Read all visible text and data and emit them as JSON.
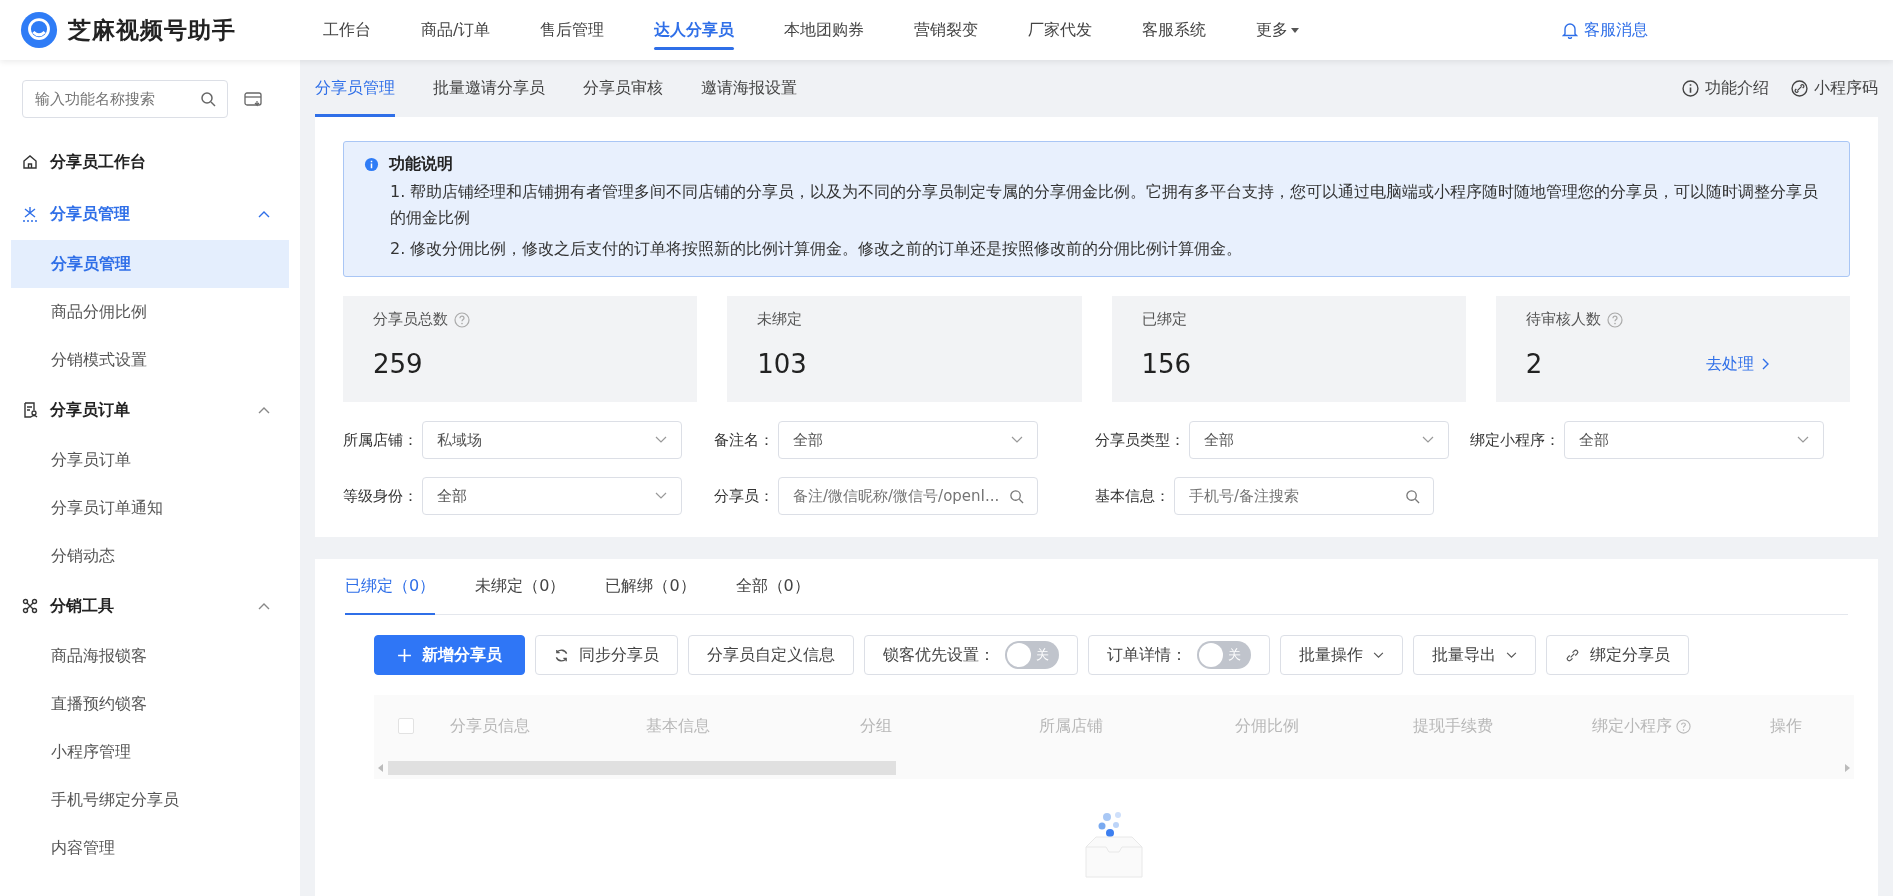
{
  "app": {
    "name": "芝麻视频号助手"
  },
  "top_nav": [
    {
      "label": "工作台",
      "selected": false
    },
    {
      "label": "商品/订单",
      "selected": false
    },
    {
      "label": "售后管理",
      "selected": false
    },
    {
      "label": "达人分享员",
      "selected": true
    },
    {
      "label": "本地团购券",
      "selected": false
    },
    {
      "label": "营销裂变",
      "selected": false
    },
    {
      "label": "厂家代发",
      "selected": false
    },
    {
      "label": "客服系统",
      "selected": false
    },
    {
      "label": "更多",
      "selected": false,
      "dropdown": true
    }
  ],
  "messages": {
    "label": "客服消息"
  },
  "sidebar": {
    "search": {
      "placeholder": "输入功能名称搜索"
    },
    "items": [
      {
        "label": "分享员工作台",
        "selected": false
      },
      {
        "label": "分享员管理",
        "selected": true,
        "expanded": true,
        "children": [
          {
            "label": "分享员管理",
            "selected": true
          },
          {
            "label": "商品分佣比例",
            "selected": false
          },
          {
            "label": "分销模式设置",
            "selected": false
          }
        ]
      },
      {
        "label": "分享员订单",
        "selected": false,
        "expanded": true,
        "children": [
          {
            "label": "分享员订单",
            "selected": false
          },
          {
            "label": "分享员订单通知",
            "selected": false
          },
          {
            "label": "分销动态",
            "selected": false
          }
        ]
      },
      {
        "label": "分销工具",
        "selected": false,
        "expanded": true,
        "children": [
          {
            "label": "商品海报锁客",
            "selected": false
          },
          {
            "label": "直播预约锁客",
            "selected": false
          },
          {
            "label": "小程序管理",
            "selected": false
          },
          {
            "label": "手机号绑定分享员",
            "selected": false
          },
          {
            "label": "内容管理",
            "selected": false
          }
        ]
      }
    ]
  },
  "sub_tabs": [
    {
      "label": "分享员管理",
      "selected": true
    },
    {
      "label": "批量邀请分享员",
      "selected": false
    },
    {
      "label": "分享员审核",
      "selected": false
    },
    {
      "label": "邀请海报设置",
      "selected": false
    }
  ],
  "header_links": [
    {
      "label": "功能介绍"
    },
    {
      "label": "小程序码"
    }
  ],
  "notice": {
    "title": "功能说明",
    "lines": [
      "1. 帮助店铺经理和店铺拥有者管理多间不同店铺的分享员，以及为不同的分享员制定专属的分享佣金比例。它拥有多平台支持，您可以通过电脑端或小程序随时随地管理您的分享员，可以随时调整分享员的佣金比例",
      "2. 修改分佣比例，修改之后支付的订单将按照新的比例计算佣金。修改之前的订单还是按照修改前的分佣比例计算佣金。"
    ]
  },
  "stats": [
    {
      "label": "分享员总数",
      "help": true,
      "value": "259"
    },
    {
      "label": "未绑定",
      "help": false,
      "value": "103"
    },
    {
      "label": "已绑定",
      "help": false,
      "value": "156"
    },
    {
      "label": "待审核人数",
      "help": true,
      "value": "2",
      "action": "去处理"
    }
  ],
  "filters": [
    {
      "label": "所属店铺：",
      "kind": "select",
      "value": "私域场"
    },
    {
      "label": "备注名：",
      "kind": "select",
      "value": "全部"
    },
    {
      "label": "分享员类型：",
      "kind": "select",
      "value": "全部"
    },
    {
      "label": "绑定小程序：",
      "kind": "select",
      "value": "全部"
    },
    {
      "label": "等级身份：",
      "kind": "select",
      "value": "全部"
    },
    {
      "label": "分享员：",
      "kind": "search",
      "placeholder": "备注/微信昵称/微信号/openI..."
    },
    {
      "label": "基本信息：",
      "kind": "search",
      "placeholder": "手机号/备注搜索"
    }
  ],
  "list_tabs": [
    {
      "label": "已绑定（0）",
      "selected": true
    },
    {
      "label": "未绑定（0）",
      "selected": false
    },
    {
      "label": "已解绑（0）",
      "selected": false
    },
    {
      "label": "全部（0）",
      "selected": false
    }
  ],
  "toolbar": [
    {
      "kind": "primary",
      "label": "新增分享员"
    },
    {
      "kind": "sync",
      "label": "同步分享员"
    },
    {
      "kind": "plain",
      "label": "分享员自定义信息"
    },
    {
      "kind": "toggle",
      "label": "锁客优先设置：",
      "on": false,
      "state_text": "关"
    },
    {
      "kind": "toggle",
      "label": "订单详情：",
      "on": false,
      "state_text": "关"
    },
    {
      "kind": "dropdown",
      "label": "批量操作"
    },
    {
      "kind": "dropdown",
      "label": "批量导出"
    },
    {
      "kind": "link",
      "label": "绑定分享员"
    }
  ],
  "table": {
    "select_all": {
      "checked": false
    },
    "columns": [
      {
        "label": "分享员信息"
      },
      {
        "label": "基本信息"
      },
      {
        "label": "分组"
      },
      {
        "label": "所属店铺"
      },
      {
        "label": "分佣比例"
      },
      {
        "label": "提现手续费"
      },
      {
        "label": "绑定小程序",
        "help": true
      },
      {
        "label": "操作"
      }
    ],
    "loading": true
  }
}
